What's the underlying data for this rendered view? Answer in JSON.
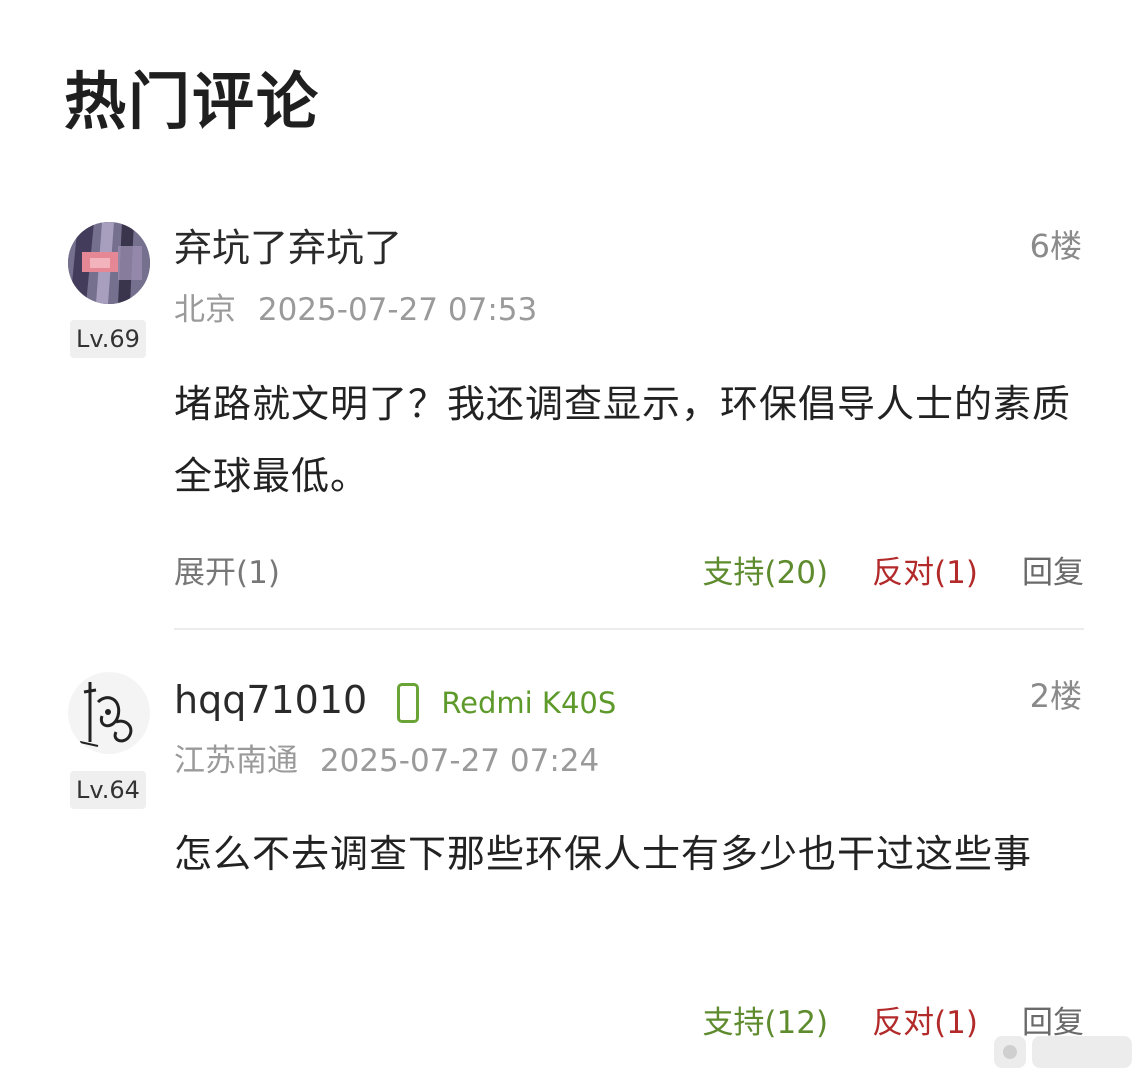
{
  "header": {
    "title": "热门评论"
  },
  "comments": [
    {
      "username": "弃坑了弃坑了",
      "floor": "6楼",
      "level": "Lv.69",
      "location": "北京",
      "time": "2025-07-27 07:53",
      "content": "堵路就文明了？我还调查显示，环保倡导人士的素质全球最低。",
      "expand": "展开(1)",
      "support": "支持(20)",
      "oppose": "反对(1)",
      "reply": "回复",
      "avatar_icon": "abstract-pink-purple-avatar"
    },
    {
      "username": "hqq71010",
      "device": "Redmi K40S",
      "floor": "2楼",
      "level": "Lv.64",
      "location": "江苏南通",
      "time": "2025-07-27 07:24",
      "content": "怎么不去调查下那些环保人士有多少也干过这些事",
      "support": "支持(12)",
      "oppose": "反对(1)",
      "reply": "回复",
      "avatar_icon": "calligraphy-sketch-avatar"
    }
  ],
  "colors": {
    "support": "#5e8b2e",
    "oppose": "#b22a2a",
    "device": "#5e9a2b",
    "meta": "#9a9a9a"
  }
}
